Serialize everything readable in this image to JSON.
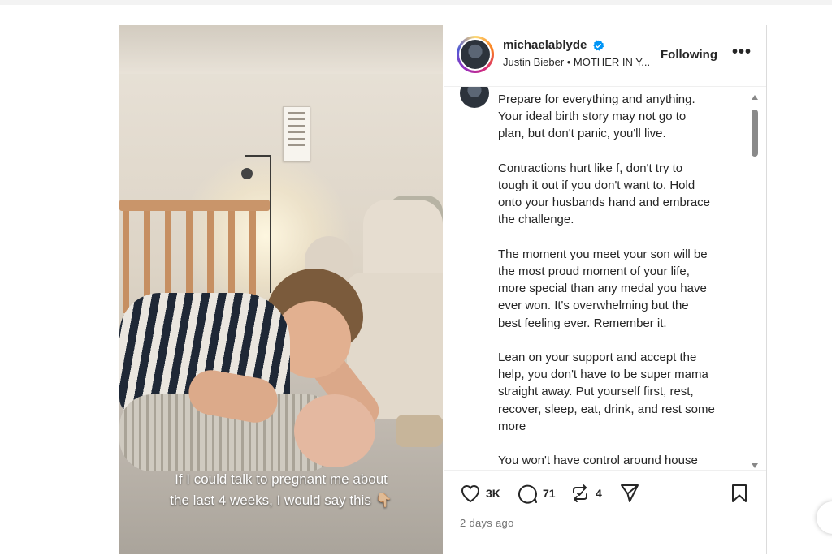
{
  "media": {
    "caption_line1": "If I could talk to pregnant me about",
    "caption_line2": "the last 4 weeks, I would say this 👇🏼"
  },
  "header": {
    "username": "michaelablyde",
    "verified": true,
    "subline": "Justin Bieber • MOTHER IN Y...",
    "follow_label": "Following",
    "more_label": "•••"
  },
  "caption_paragraphs": [
    "Prepare for everything and anything.\nYour ideal birth story may not go to\nplan, but don't panic, you'll live.",
    "Contractions hurt like f, don't try to\ntough it out if you don't want to. Hold\nonto your husbands hand and embrace\nthe challenge.",
    "The moment you meet your son will be\nthe most proud moment of your life,\nmore special than any medal you have\never won. It's overwhelming but the\nbest feeling ever. Remember it.",
    "Lean on your support and accept the\nhelp, you don't have to be super mama\nstraight away. Put yourself first, rest,\nrecover, sleep, eat, drink, and rest some\nmore",
    "You won't have control around house"
  ],
  "actions": {
    "likes": "3K",
    "comments": "71",
    "reposts": "4",
    "timestamp": "2 days ago"
  },
  "icons": {
    "like": "heart-icon",
    "comment": "comment-bubble-icon",
    "repost": "repost-icon",
    "share": "paper-plane-icon",
    "save": "bookmark-icon",
    "verified": "verified-badge-icon"
  },
  "colors": {
    "verified": "#0095f6",
    "text": "#262626",
    "muted": "#737373"
  }
}
